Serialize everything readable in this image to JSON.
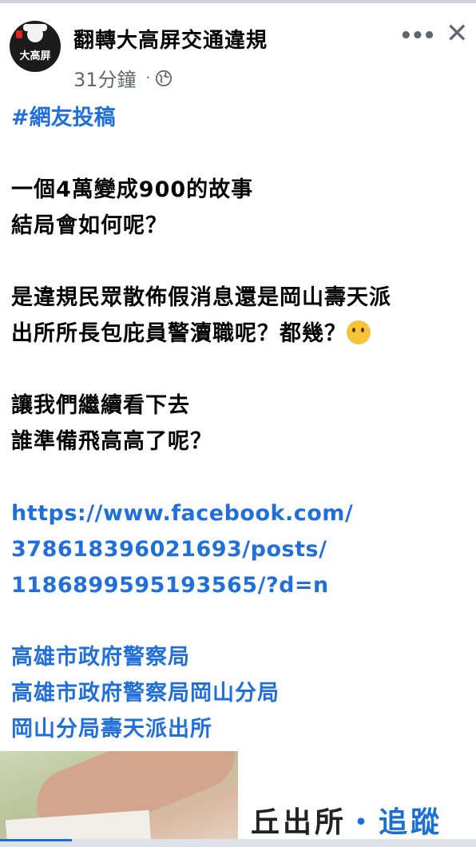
{
  "header": {
    "page_name": "翻轉大高屏交通違規",
    "time": "31分鐘",
    "dot": "·",
    "avatar_text": "大高屏",
    "more_label": "•••",
    "close_label": "✕"
  },
  "post": {
    "hashtag": "#網友投稿",
    "paragraph1": [
      "一個4萬變成900的故事",
      "結局會如何呢？"
    ],
    "paragraph2": [
      "是違規民眾散佈假消息還是岡山壽天派",
      "出所所長包庇員警瀆職呢？都幾？"
    ],
    "paragraph3": [
      "讓我們繼續看下去",
      "誰準備飛高高了呢？"
    ],
    "link_lines": [
      "https://www.facebook.com/",
      "378618396021693/posts/",
      "1186899595193565/?d=n"
    ],
    "page_tags": [
      "高雄市政府警察局",
      "高雄市政府警察局岡山分局",
      "岡山分局壽天派出所"
    ]
  },
  "preview": {
    "doc_text_black": "丘出所",
    "doc_text_blue": "・追蹤"
  },
  "colors": {
    "link": "#216fdb",
    "meta": "#65676b",
    "emoji": "#f7c33b"
  },
  "icons": [
    "globe-icon",
    "more-icon",
    "close-icon",
    "shushing-face-emoji"
  ]
}
